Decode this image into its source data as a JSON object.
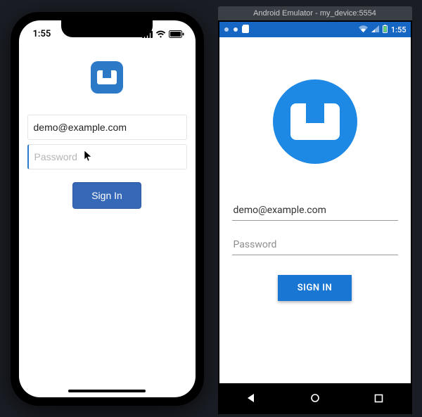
{
  "ios": {
    "status_time": "1:55",
    "logo_letter": "app-logo",
    "email_value": "demo@example.com",
    "password_placeholder": "Password",
    "password_value": "",
    "signin_label": "Sign In"
  },
  "android": {
    "window_title": "Android Emulator - my_device:5554",
    "status_time": "1:55",
    "email_value": "demo@example.com",
    "password_placeholder": "Password",
    "password_value": "",
    "signin_label": "SIGN IN"
  },
  "colors": {
    "ios_accent": "#3568b6",
    "android_accent": "#1976d2",
    "logo_blue": "#1e88e5"
  }
}
